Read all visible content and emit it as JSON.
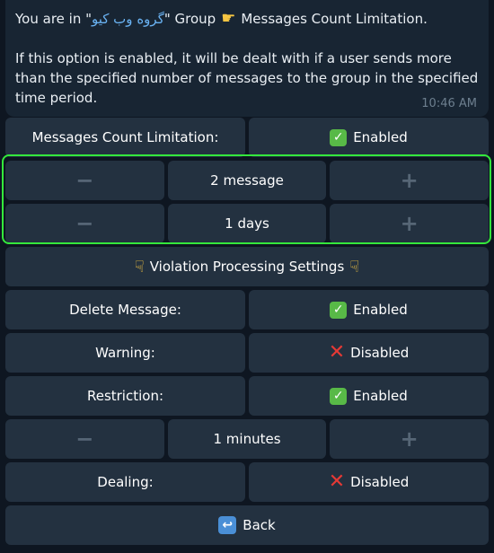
{
  "message": {
    "line_prefix": "You are in \"",
    "group_name": "گروه وب کیو",
    "line_middle": "\" Group",
    "line_suffix": "Messages Count Limitation.",
    "body": "If this option is enabled, it will be dealt with if a user sends more than the specified number of messages to the group in the specified time period.",
    "time": "10:46 AM"
  },
  "keyboard": {
    "limitation_label": "Messages Count Limitation:",
    "limitation_status": "Enabled",
    "count_value": "2 message",
    "period_value": "1 days",
    "minus": "−",
    "plus": "+",
    "violation_title": "Violation Processing Settings",
    "delete_label": "Delete Message:",
    "delete_status": "Enabled",
    "warning_label": "Warning:",
    "warning_status": "Disabled",
    "restriction_label": "Restriction:",
    "restriction_status": "Enabled",
    "minutes_value": "1 minutes",
    "dealing_label": "Dealing:",
    "dealing_status": "Disabled",
    "back_label": "Back"
  },
  "colors": {
    "background": "#0e1621",
    "bubble": "#182533",
    "button": "#233140",
    "link": "#6ab3f3",
    "enabled_green": "#58b947",
    "disabled_red": "#e53935",
    "highlight_outline": "#34e83c"
  },
  "icons": {
    "pointing_right": "backhand-index-pointing-right-icon",
    "pointing_down": "backhand-index-pointing-down-icon",
    "check": "check-mark-button-icon",
    "cross": "cross-mark-icon",
    "back": "back-arrow-icon"
  }
}
